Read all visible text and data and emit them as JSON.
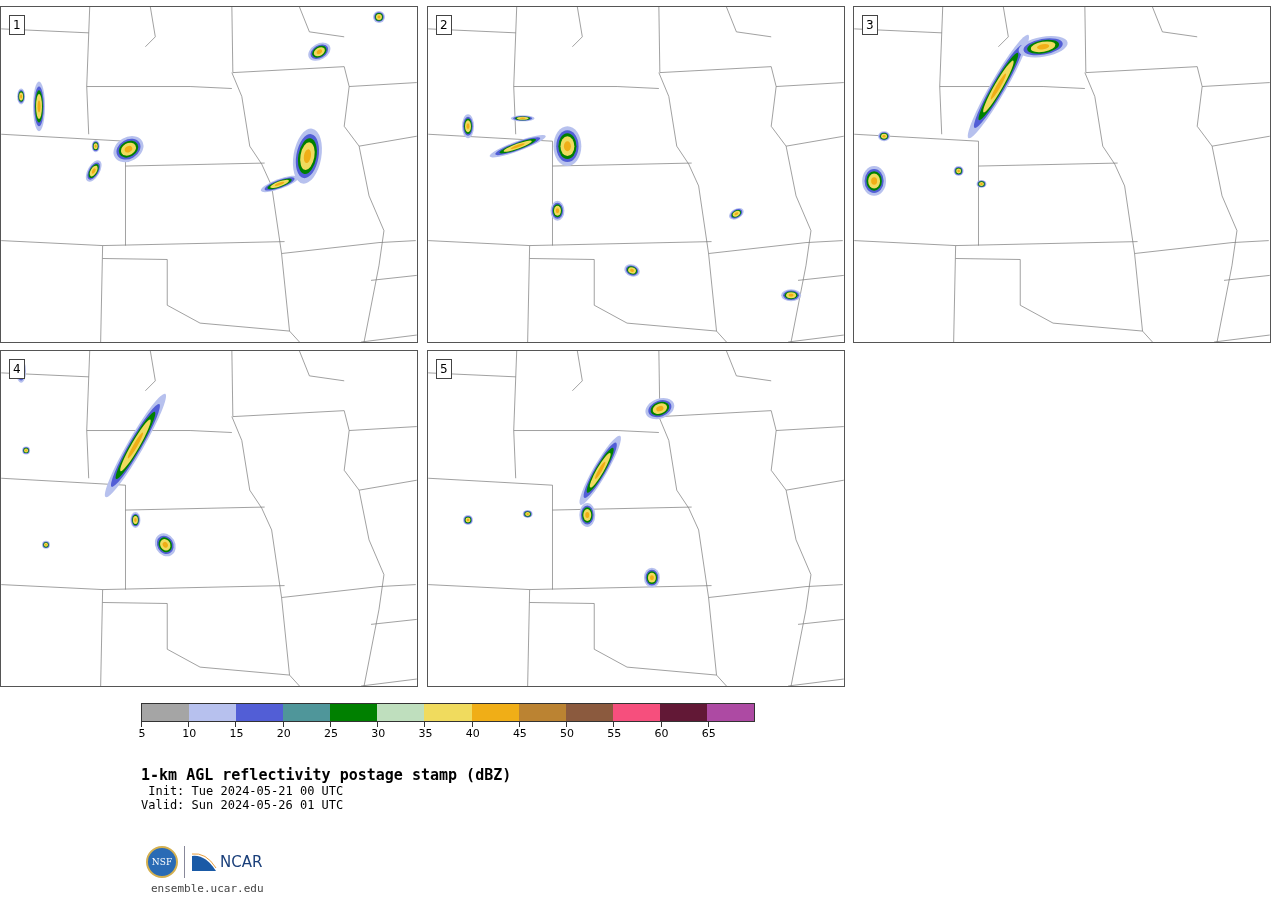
{
  "panels": [
    {
      "label": "1"
    },
    {
      "label": "2"
    },
    {
      "label": "3"
    },
    {
      "label": "4"
    },
    {
      "label": "5"
    }
  ],
  "colorbar": {
    "segments": [
      {
        "color": "#a5a5a5"
      },
      {
        "color": "#b7c1ee"
      },
      {
        "color": "#525ed6"
      },
      {
        "color": "#4f969a"
      },
      {
        "color": "#008000"
      },
      {
        "color": "#bfdfbe"
      },
      {
        "color": "#f0db5e"
      },
      {
        "color": "#f0ae17"
      },
      {
        "color": "#bb8332"
      },
      {
        "color": "#8b5a3e"
      },
      {
        "color": "#f64f7d"
      },
      {
        "color": "#621836"
      },
      {
        "color": "#ad4aa3"
      }
    ],
    "ticks": [
      "5",
      "10",
      "15",
      "20",
      "25",
      "30",
      "35",
      "40",
      "45",
      "50",
      "55",
      "60",
      "65"
    ]
  },
  "title": "1-km AGL reflectivity postage stamp (dBZ)",
  "init": " Init: Tue 2024-05-21 00 UTC",
  "valid": "Valid: Sun 2024-05-26 01 UTC",
  "logos": {
    "nsf": "NSF",
    "ncar": "NCAR"
  },
  "footer_url": "ensemble.ucar.edu"
}
